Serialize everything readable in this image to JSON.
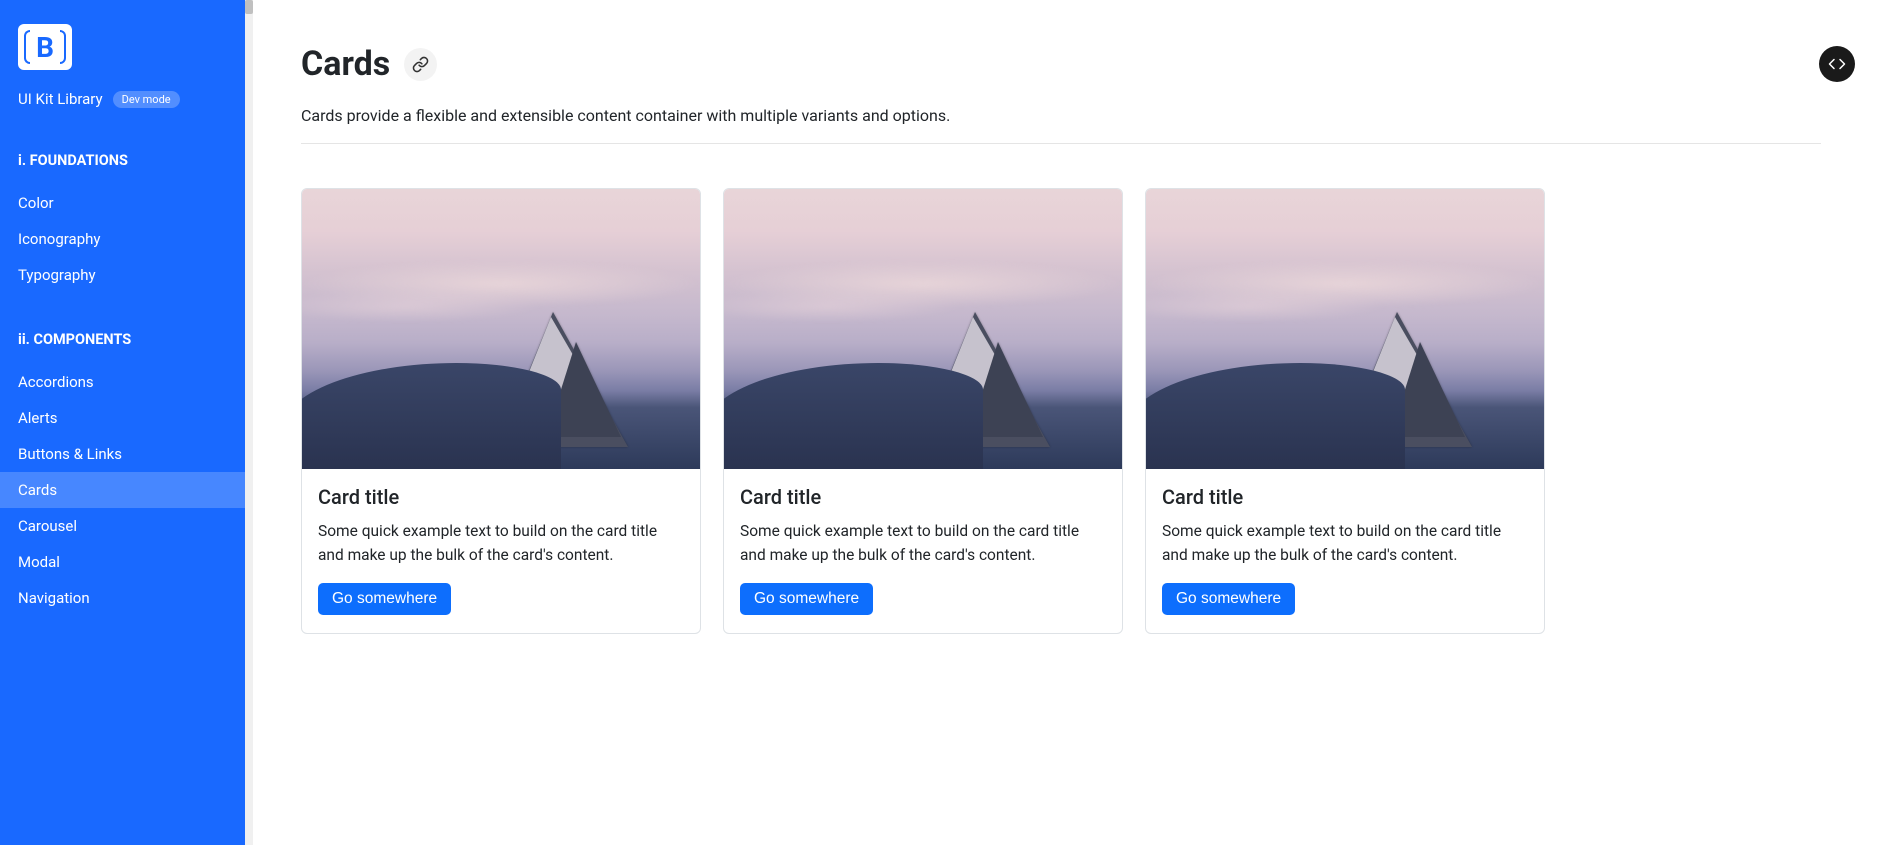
{
  "sidebar": {
    "library_name": "UI Kit Library",
    "badge": "Dev mode",
    "sections": [
      {
        "title": "i. FOUNDATIONS",
        "items": [
          "Color",
          "Iconography",
          "Typography"
        ]
      },
      {
        "title": "ii. COMPONENTS",
        "items": [
          "Accordions",
          "Alerts",
          "Buttons & Links",
          "Cards",
          "Carousel",
          "Modal",
          "Navigation"
        ]
      }
    ],
    "active_item": "Cards"
  },
  "page": {
    "title": "Cards",
    "description": "Cards provide a flexible and extensible content container with multiple variants and options."
  },
  "cards": [
    {
      "title": "Card title",
      "text": "Some quick example text to build on the card title and make up the bulk of the card's content.",
      "button": "Go somewhere"
    },
    {
      "title": "Card title",
      "text": "Some quick example text to build on the card title and make up the bulk of the card's content.",
      "button": "Go somewhere"
    },
    {
      "title": "Card title",
      "text": "Some quick example text to build on the card title and make up the bulk of the card's content.",
      "button": "Go somewhere"
    }
  ],
  "icons": {
    "logo_letter": "B"
  }
}
